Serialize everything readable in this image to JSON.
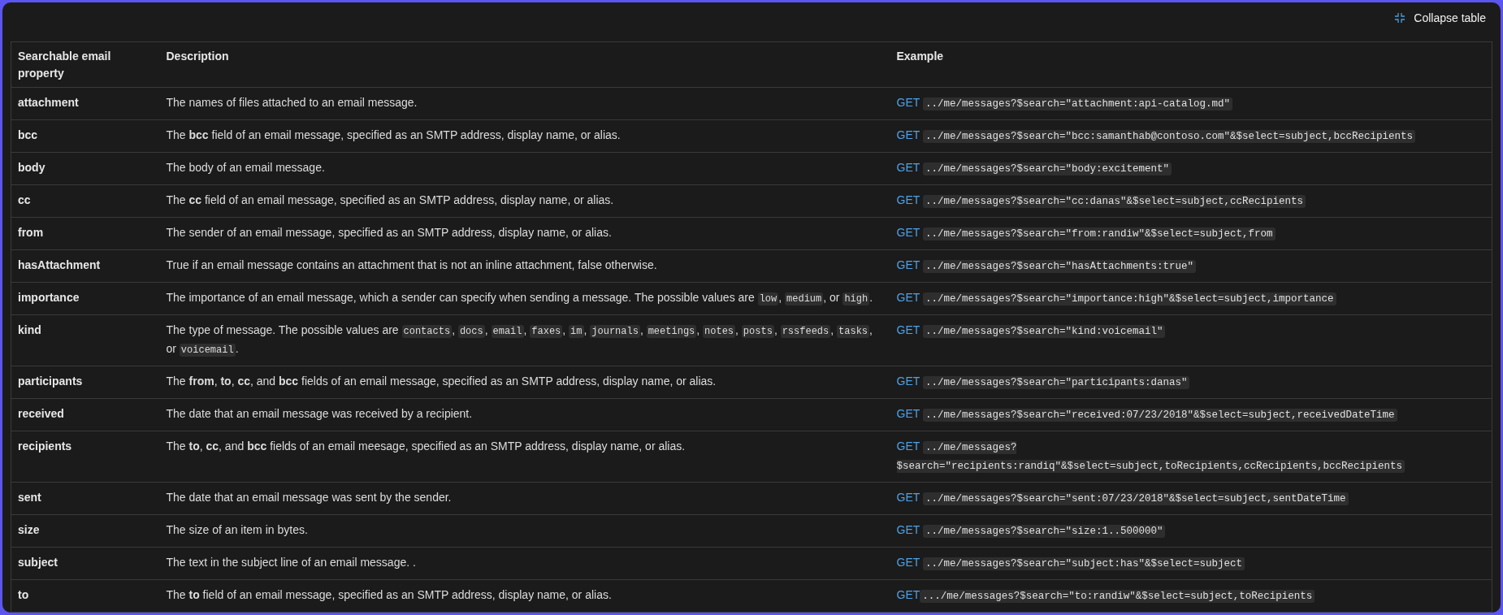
{
  "collapse_button": {
    "label": "Collapse table"
  },
  "table": {
    "columns": [
      "Searchable email property",
      "Description",
      "Example"
    ],
    "rows": [
      {
        "property": "attachment",
        "description": [
          {
            "kind": "text",
            "text": "The names of files attached to an email message."
          }
        ],
        "example": {
          "method": "GET",
          "code": "../me/messages?$search=\"attachment:api-catalog.md\"",
          "spaced": true
        }
      },
      {
        "property": "bcc",
        "description": [
          {
            "kind": "text",
            "text": "The **bcc** field of an email message, specified as an SMTP address, display name, or alias."
          }
        ],
        "example": {
          "method": "GET",
          "code": "../me/messages?$search=\"bcc:samanthab@contoso.com\"&$select=subject,bccRecipients",
          "spaced": true
        }
      },
      {
        "property": "body",
        "description": [
          {
            "kind": "text",
            "text": "The body of an email message."
          }
        ],
        "example": {
          "method": "GET",
          "code": "../me/messages?$search=\"body:excitement\"",
          "spaced": true
        }
      },
      {
        "property": "cc",
        "description": [
          {
            "kind": "text",
            "text": "The **cc** field of an email message, specified as an SMTP address, display name, or alias."
          }
        ],
        "example": {
          "method": "GET",
          "code": "../me/messages?$search=\"cc:danas\"&$select=subject,ccRecipients",
          "spaced": true
        }
      },
      {
        "property": "from",
        "description": [
          {
            "kind": "text",
            "text": "The sender of an email message, specified as an SMTP address, display name, or alias."
          }
        ],
        "example": {
          "method": "GET",
          "code": "../me/messages?$search=\"from:randiw\"&$select=subject,from",
          "spaced": true
        }
      },
      {
        "property": "hasAttachment",
        "description": [
          {
            "kind": "text",
            "text": "True if an email message contains an attachment that is not an inline attachment, false otherwise."
          }
        ],
        "example": {
          "method": "GET",
          "code": "../me/messages?$search=\"hasAttachments:true\"",
          "spaced": true
        }
      },
      {
        "property": "importance",
        "description": [
          {
            "kind": "text",
            "text": "The importance of an email message, which a sender can specify when sending a message. The possible values are "
          },
          {
            "kind": "code",
            "text": "low"
          },
          {
            "kind": "text",
            "text": ", "
          },
          {
            "kind": "code",
            "text": "medium"
          },
          {
            "kind": "text",
            "text": ", or "
          },
          {
            "kind": "code",
            "text": "high"
          },
          {
            "kind": "text",
            "text": "."
          }
        ],
        "example": {
          "method": "GET",
          "code": "../me/messages?$search=\"importance:high\"&$select=subject,importance",
          "spaced": true
        }
      },
      {
        "property": "kind",
        "description": [
          {
            "kind": "text",
            "text": "The type of message. The possible values are "
          },
          {
            "kind": "code",
            "text": "contacts"
          },
          {
            "kind": "text",
            "text": ", "
          },
          {
            "kind": "code",
            "text": "docs"
          },
          {
            "kind": "text",
            "text": ", "
          },
          {
            "kind": "code",
            "text": "email"
          },
          {
            "kind": "text",
            "text": ", "
          },
          {
            "kind": "code",
            "text": "faxes"
          },
          {
            "kind": "text",
            "text": ", "
          },
          {
            "kind": "code",
            "text": "im"
          },
          {
            "kind": "text",
            "text": ", "
          },
          {
            "kind": "code",
            "text": "journals"
          },
          {
            "kind": "text",
            "text": ", "
          },
          {
            "kind": "code",
            "text": "meetings"
          },
          {
            "kind": "text",
            "text": ", "
          },
          {
            "kind": "code",
            "text": "notes"
          },
          {
            "kind": "text",
            "text": ", "
          },
          {
            "kind": "code",
            "text": "posts"
          },
          {
            "kind": "text",
            "text": ", "
          },
          {
            "kind": "code",
            "text": "rssfeeds"
          },
          {
            "kind": "text",
            "text": ", "
          },
          {
            "kind": "code",
            "text": "tasks"
          },
          {
            "kind": "text",
            "text": ", or "
          },
          {
            "kind": "code",
            "text": "voicemail"
          },
          {
            "kind": "text",
            "text": "."
          }
        ],
        "example": {
          "method": "GET",
          "code": "../me/messages?$search=\"kind:voicemail\"",
          "spaced": true
        }
      },
      {
        "property": "participants",
        "description": [
          {
            "kind": "text",
            "text": "The **from**, **to**, **cc**, and **bcc** fields of an email message, specified as an SMTP address, display name, or alias."
          }
        ],
        "example": {
          "method": "GET",
          "code": "../me/messages?$search=\"participants:danas\"",
          "spaced": true
        }
      },
      {
        "property": "received",
        "description": [
          {
            "kind": "text",
            "text": "The date that an email message was received by a recipient."
          }
        ],
        "example": {
          "method": "GET",
          "code": "../me/messages?$search=\"received:07/23/2018\"&$select=subject,receivedDateTime",
          "spaced": true
        }
      },
      {
        "property": "recipients",
        "description": [
          {
            "kind": "text",
            "text": "The **to**, **cc**, and **bcc** fields of an email meesage, specified as an SMTP address, display name, or alias."
          }
        ],
        "example": {
          "method": "GET",
          "code": "../me/messages?$search=\"recipients:randiq\"&$select=subject,toRecipients,ccRecipients,bccRecipients",
          "spaced": true
        }
      },
      {
        "property": "sent",
        "description": [
          {
            "kind": "text",
            "text": "The date that an email message was sent by the sender."
          }
        ],
        "example": {
          "method": "GET",
          "code": "../me/messages?$search=\"sent:07/23/2018\"&$select=subject,sentDateTime",
          "spaced": true
        }
      },
      {
        "property": "size",
        "description": [
          {
            "kind": "text",
            "text": "The size of an item in bytes."
          }
        ],
        "example": {
          "method": "GET",
          "code": "../me/messages?$search=\"size:1..500000\"",
          "spaced": true
        }
      },
      {
        "property": "subject",
        "description": [
          {
            "kind": "text",
            "text": "The text in the subject line of an email message. ."
          }
        ],
        "example": {
          "method": "GET",
          "code": "../me/messages?$search=\"subject:has\"&$select=subject",
          "spaced": true
        }
      },
      {
        "property": "to",
        "description": [
          {
            "kind": "text",
            "text": "The **to** field of an email message, specified as an SMTP address, display name, or alias."
          }
        ],
        "example": {
          "method": "GET",
          "code": ".../me/messages?$search=\"to:randiw\"&$select=subject,toRecipients",
          "spaced": false
        }
      }
    ]
  }
}
